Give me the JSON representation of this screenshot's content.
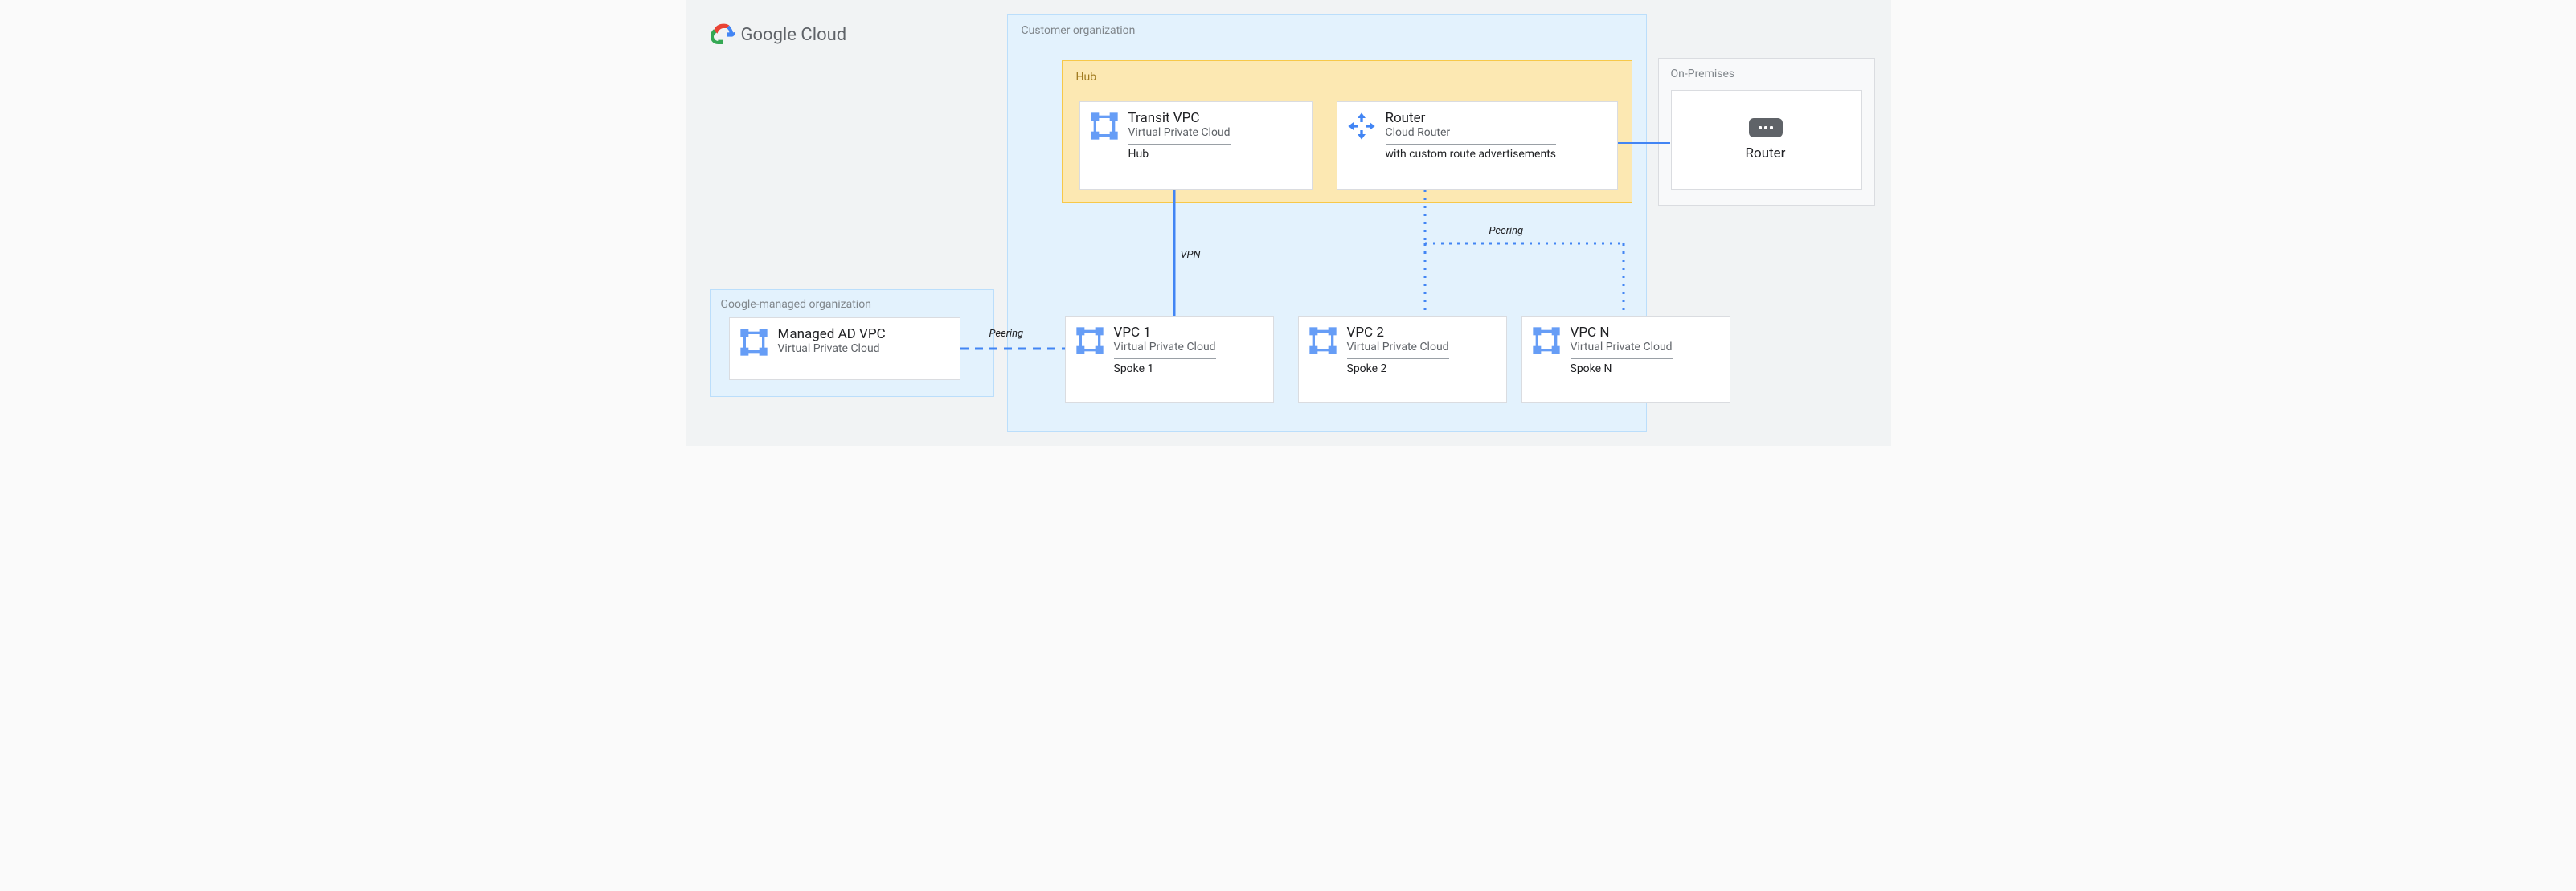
{
  "brand": "Google Cloud",
  "labels": {
    "google_org": "Google-managed organization",
    "customer_org": "Customer organization",
    "hub": "Hub",
    "onprem": "On-Premises"
  },
  "edges": {
    "peering_left": "Peering",
    "vpn": "VPN",
    "peering_right": "Peering"
  },
  "hub_nodes": {
    "transit": {
      "title": "Transit VPC",
      "sub": "Virtual Private Cloud",
      "extra": "Hub"
    },
    "router": {
      "title": "Router",
      "sub": "Cloud Router",
      "extra": "with custom route advertisements"
    }
  },
  "spokes": [
    {
      "title": "VPC 1",
      "sub": "Virtual Private Cloud",
      "extra": "Spoke 1"
    },
    {
      "title": "VPC 2",
      "sub": "Virtual Private Cloud",
      "extra": "Spoke 2"
    },
    {
      "title": "VPC N",
      "sub": "Virtual Private Cloud",
      "extra": "Spoke N"
    }
  ],
  "managed_ad": {
    "title": "Managed AD VPC",
    "sub": "Virtual Private Cloud"
  },
  "onprem_router": {
    "title": "Router"
  }
}
